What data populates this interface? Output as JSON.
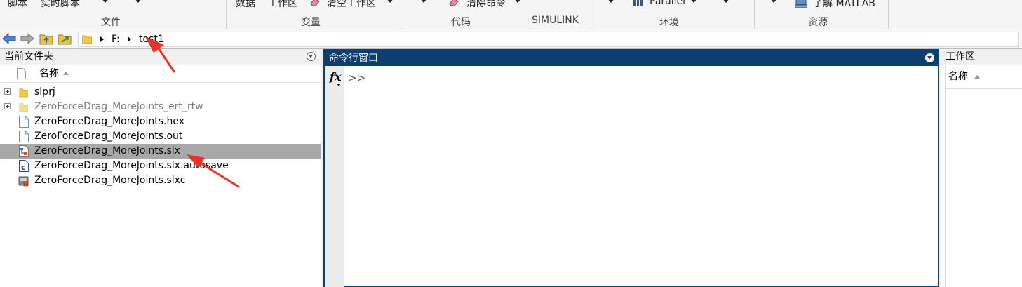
{
  "ribbon": {
    "items": {
      "script": "脚本",
      "live_script": "实时脚本",
      "data": "数据",
      "workspace": "工作区",
      "clear_workspace": "清空工作区",
      "clear_commands": "清除命令",
      "parallel": "Parallel",
      "learn_matlab": "了解 MATLAB"
    },
    "sections": {
      "file": "文件",
      "variable": "变量",
      "code": "代码",
      "simulink": "SIMULINK",
      "environment": "环境",
      "resources": "资源"
    }
  },
  "address": {
    "drive": "F:",
    "folder": "test1"
  },
  "current_folder": {
    "title": "当前文件夹",
    "column_name": "名称",
    "files": [
      {
        "name": "slprj",
        "type": "folder",
        "expandable": true,
        "dimmed": false,
        "selected": false
      },
      {
        "name": "ZeroForceDrag_MoreJoints_ert_rtw",
        "type": "folder",
        "expandable": true,
        "dimmed": true,
        "selected": false
      },
      {
        "name": "ZeroForceDrag_MoreJoints.hex",
        "type": "file",
        "expandable": false,
        "dimmed": false,
        "selected": false
      },
      {
        "name": "ZeroForceDrag_MoreJoints.out",
        "type": "file",
        "expandable": false,
        "dimmed": false,
        "selected": false
      },
      {
        "name": "ZeroForceDrag_MoreJoints.slx",
        "type": "simulink-model",
        "expandable": false,
        "dimmed": false,
        "selected": true
      },
      {
        "name": "ZeroForceDrag_MoreJoints.slx.autosave",
        "type": "c-file",
        "expandable": false,
        "dimmed": false,
        "selected": false
      },
      {
        "name": "ZeroForceDrag_MoreJoints.slxc",
        "type": "cache-file",
        "expandable": false,
        "dimmed": false,
        "selected": false
      }
    ]
  },
  "command_window": {
    "title": "命令行窗口",
    "fx": "fx",
    "prompt": ">>"
  },
  "workspace": {
    "title": "工作区",
    "column_name": "名称"
  },
  "colors": {
    "command_title_bg": "#0c3e72",
    "selected_row_bg": "#a8a8a8",
    "annotation_arrow": "#e8322a"
  }
}
